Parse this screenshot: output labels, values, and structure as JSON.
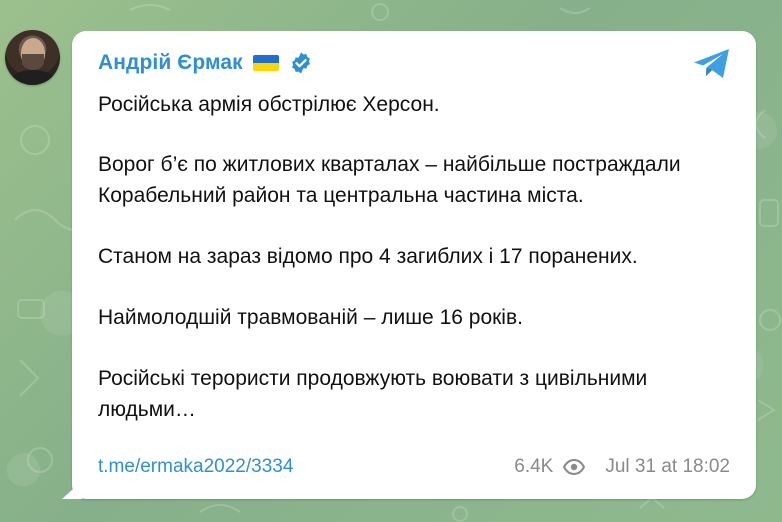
{
  "post": {
    "author": "Андрій Єрмак",
    "flag": "ukraine-flag",
    "verified": "verified-badge",
    "channel_icon": "telegram-icon",
    "paragraphs": [
      "Російська армія обстрілює Херсон.",
      "Ворог б’є по житлових кварталах – найбільше постраждали Корабельний район та центральна частина міста.",
      "Станом на зараз відомо про 4 загиблих і 17 поранених.",
      "Наймолодшій травмованій – лише 16 років.",
      "Російські терористи продовжують воювати з цивільними людьми…"
    ],
    "link": "t.me/ermaka2022/3334",
    "views": "6.4K",
    "timestamp": "Jul 31 at 18:02"
  },
  "colors": {
    "accent": "#2f8fd5",
    "background": "#8fb58a",
    "bubble": "#ffffff",
    "meta_text": "#8a8a8a"
  }
}
